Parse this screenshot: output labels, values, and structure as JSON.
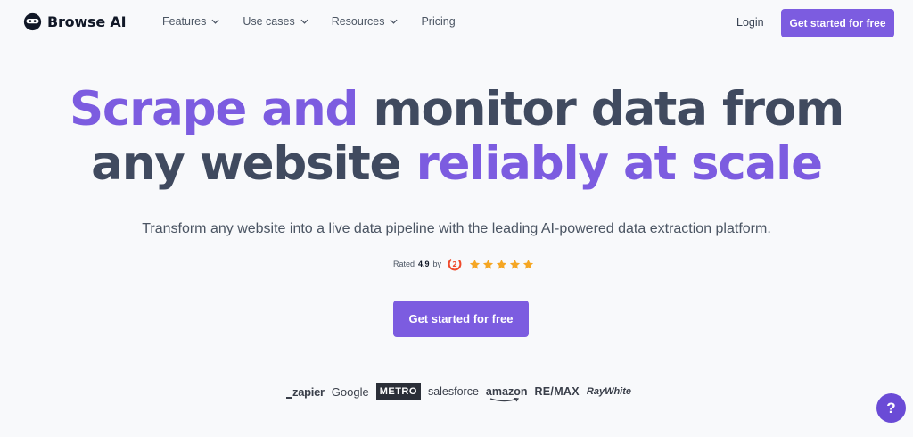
{
  "brand": {
    "name": "Browse AI",
    "logo_icon": "ninja-robot-logo"
  },
  "nav": {
    "items": [
      {
        "label": "Features",
        "has_dropdown": true
      },
      {
        "label": "Use cases",
        "has_dropdown": true
      },
      {
        "label": "Resources",
        "has_dropdown": true
      },
      {
        "label": "Pricing",
        "has_dropdown": false
      }
    ],
    "login_label": "Login",
    "cta_label": "Get started for free"
  },
  "hero": {
    "headline_line1_a": "Scrape and",
    "headline_line1_b": "monitor data from",
    "headline_line2_a": "any website",
    "headline_line2_b": "reliably at scale",
    "subtitle": "Transform any website into a live data pipeline with the leading AI-powered data extraction platform.",
    "rating_prefix": "Rated",
    "rating_value": "4.9",
    "rating_suffix": "by",
    "rating_icon": "g2-icon",
    "stars": 5,
    "cta_label": "Get started for free"
  },
  "logos": {
    "zapier": "zapier",
    "google": "Google",
    "metro": "METRO",
    "salesforce": "salesforce",
    "amazon": "amazon",
    "remax": "RE/MAX",
    "raywhite": "RayWhite"
  },
  "help": {
    "label": "?",
    "icon": "help-icon"
  },
  "colors": {
    "accent": "#7c5ce0",
    "headline_slate": "#404a5f",
    "background": "#f8f9fb",
    "star": "#f5a623",
    "g2": "#ef4a2c"
  }
}
